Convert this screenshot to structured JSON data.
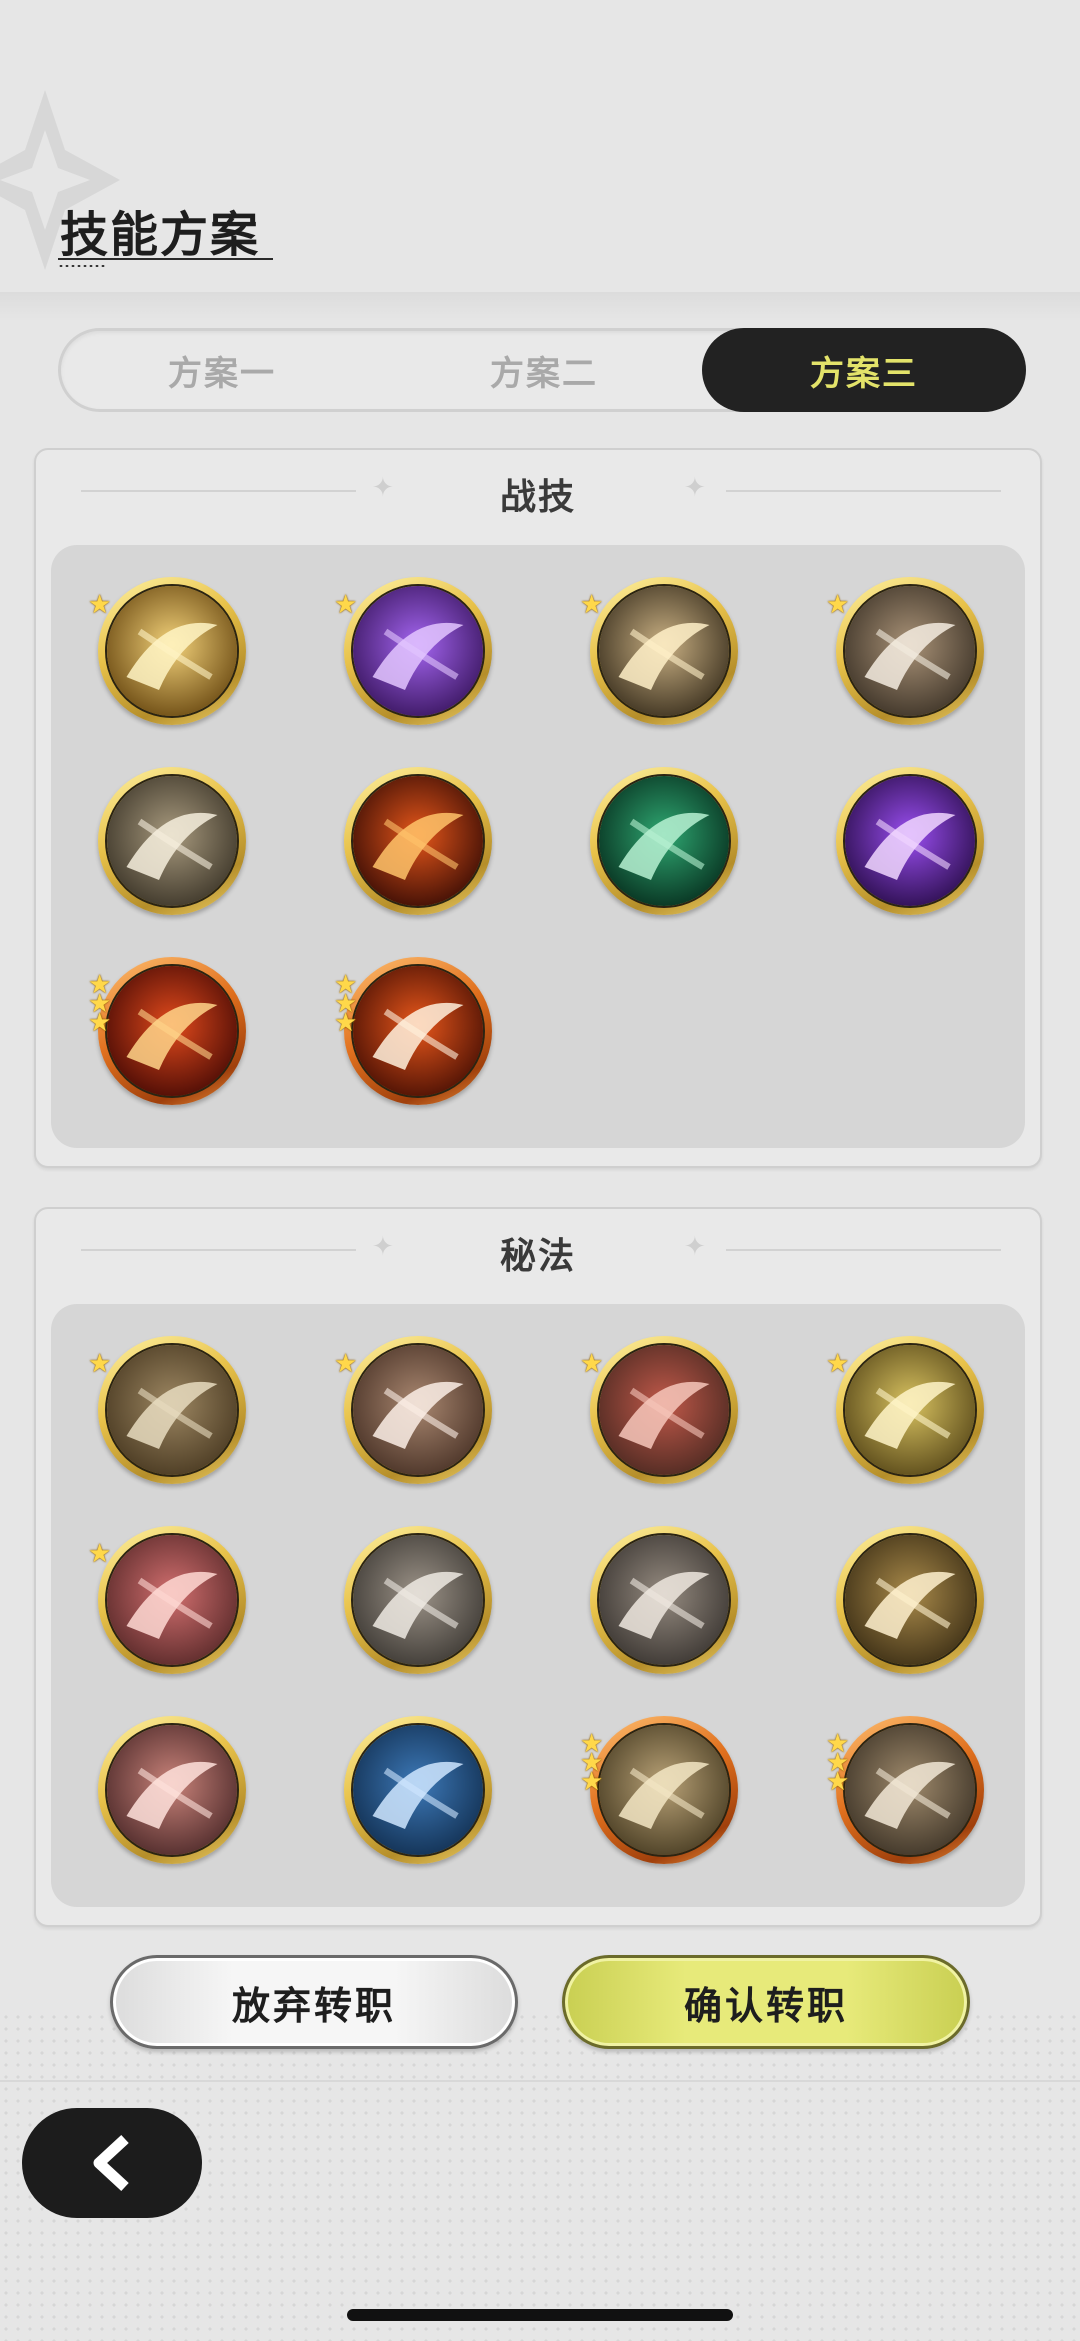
{
  "header": {
    "title": "技能方案"
  },
  "tabs": [
    {
      "label": "方案一",
      "active": false
    },
    {
      "label": "方案二",
      "active": false
    },
    {
      "label": "方案三",
      "active": true
    }
  ],
  "combat": {
    "title": "战技",
    "skills": [
      {
        "name": "golden-swirl-icon",
        "stars": 1,
        "rarity": "gold"
      },
      {
        "name": "purple-roses-icon",
        "stars": 1,
        "rarity": "gold"
      },
      {
        "name": "lightning-slash-icon",
        "stars": 1,
        "rarity": "gold"
      },
      {
        "name": "stampede-icon",
        "stars": 1,
        "rarity": "gold"
      },
      {
        "name": "wind-slash-icon",
        "stars": 0,
        "rarity": "gold"
      },
      {
        "name": "fire-swirl-icon",
        "stars": 0,
        "rarity": "gold"
      },
      {
        "name": "green-vortex-icon",
        "stars": 0,
        "rarity": "gold"
      },
      {
        "name": "purple-ghost-icon",
        "stars": 0,
        "rarity": "gold"
      },
      {
        "name": "fire-slash-icon",
        "stars": 3,
        "rarity": "orange"
      },
      {
        "name": "flame-figure-icon",
        "stars": 3,
        "rarity": "orange"
      }
    ]
  },
  "secret": {
    "title": "秘法",
    "skills": [
      {
        "name": "dragon-relief-icon",
        "stars": 1,
        "rarity": "gold"
      },
      {
        "name": "heart-shield-icon",
        "stars": 1,
        "rarity": "gold"
      },
      {
        "name": "crystal-rock-icon",
        "stars": 1,
        "rarity": "gold"
      },
      {
        "name": "power-up-figure-icon",
        "stars": 1,
        "rarity": "gold"
      },
      {
        "name": "pink-flower-icon",
        "stars": 1,
        "rarity": "gold"
      },
      {
        "name": "swordsman-shield-icon",
        "stars": 0,
        "rarity": "gold"
      },
      {
        "name": "sword-icon",
        "stars": 0,
        "rarity": "gold"
      },
      {
        "name": "sun-burst-icon",
        "stars": 0,
        "rarity": "gold"
      },
      {
        "name": "pink-slash-icon",
        "stars": 0,
        "rarity": "gold"
      },
      {
        "name": "blue-crest-icon",
        "stars": 0,
        "rarity": "gold"
      },
      {
        "name": "team-figures-icon",
        "stars": 3,
        "rarity": "orange"
      },
      {
        "name": "guardian-figure-icon",
        "stars": 3,
        "rarity": "orange"
      }
    ]
  },
  "actions": {
    "giveup_label": "放弃转职",
    "confirm_label": "确认转职"
  },
  "colors": {
    "accent_yellow": "#e3e36a",
    "dark": "#222222",
    "confirm_button": "#e7ea7a"
  }
}
